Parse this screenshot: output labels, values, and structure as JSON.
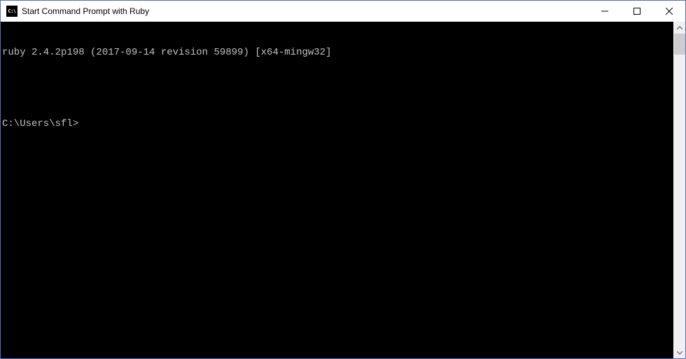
{
  "window": {
    "title": "Start Command Prompt with Ruby",
    "icon_label": "C:\\"
  },
  "terminal": {
    "lines": [
      "ruby 2.4.2p198 (2017-09-14 revision 59899) [x64-mingw32]",
      "",
      "C:\\Users\\sfl>"
    ]
  }
}
